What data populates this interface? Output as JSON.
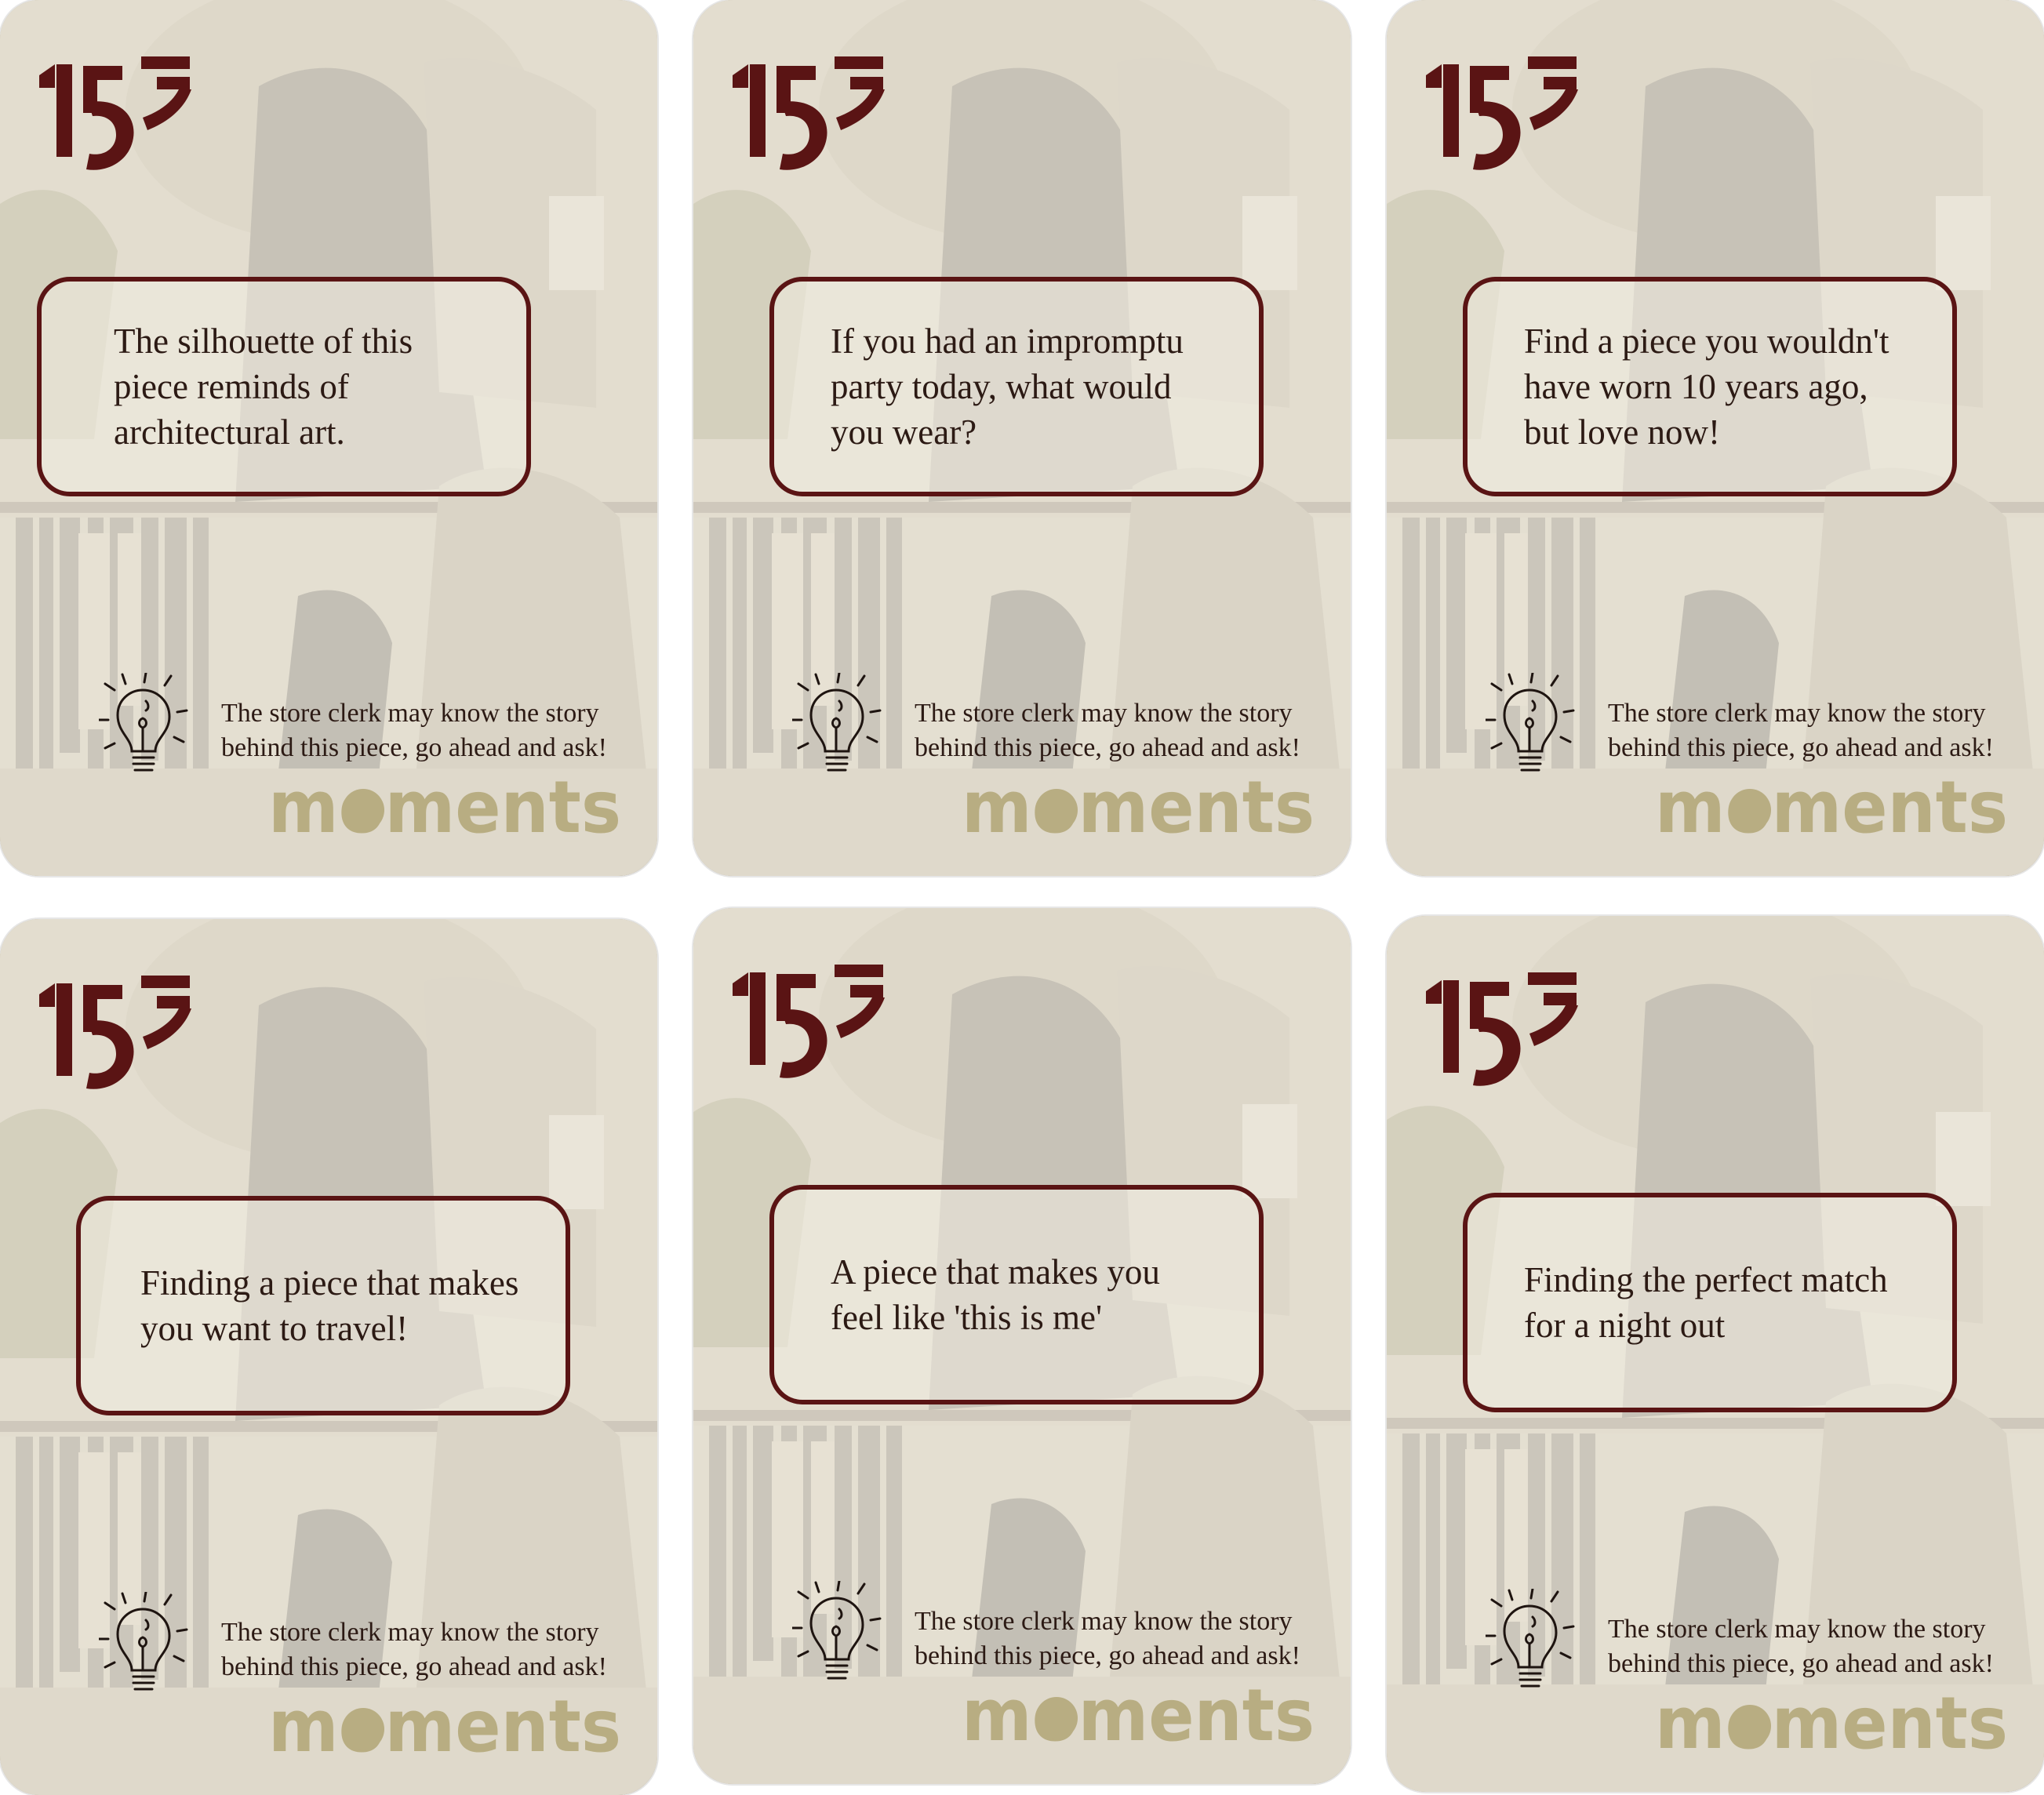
{
  "colors": {
    "accent": "#5a1414",
    "brand": "#b8ad82",
    "text": "#2c1a14"
  },
  "cards": [
    {
      "prompt": "The silhouette of this piece reminds of architectural art.",
      "hint": "The store clerk may know the story behind this piece, go ahead and ask!",
      "brand": "moments",
      "logo_text": "157"
    },
    {
      "prompt": "If you had an impromptu party today, what would you wear?",
      "hint": "The store clerk may know the story behind this piece, go ahead and ask!",
      "brand": "moments",
      "logo_text": "157"
    },
    {
      "prompt": "Find a piece you wouldn't have worn 10 years ago, but love now!",
      "hint": "The store clerk may know the story behind this piece, go ahead and ask!",
      "brand": "moments",
      "logo_text": "157"
    },
    {
      "prompt": "Finding a piece that makes you want to travel!",
      "hint": "The store clerk may know the story behind this piece, go ahead and ask!",
      "brand": "moments",
      "logo_text": "157"
    },
    {
      "prompt": "A piece that makes you feel like 'this is me'",
      "hint": "The store clerk may know the story behind this piece, go ahead and ask!",
      "brand": "moments",
      "logo_text": "157"
    },
    {
      "prompt": "Finding the perfect match for a night out",
      "hint": "The store clerk may know the story behind this piece, go ahead and ask!",
      "brand": "moments",
      "logo_text": "157"
    }
  ]
}
